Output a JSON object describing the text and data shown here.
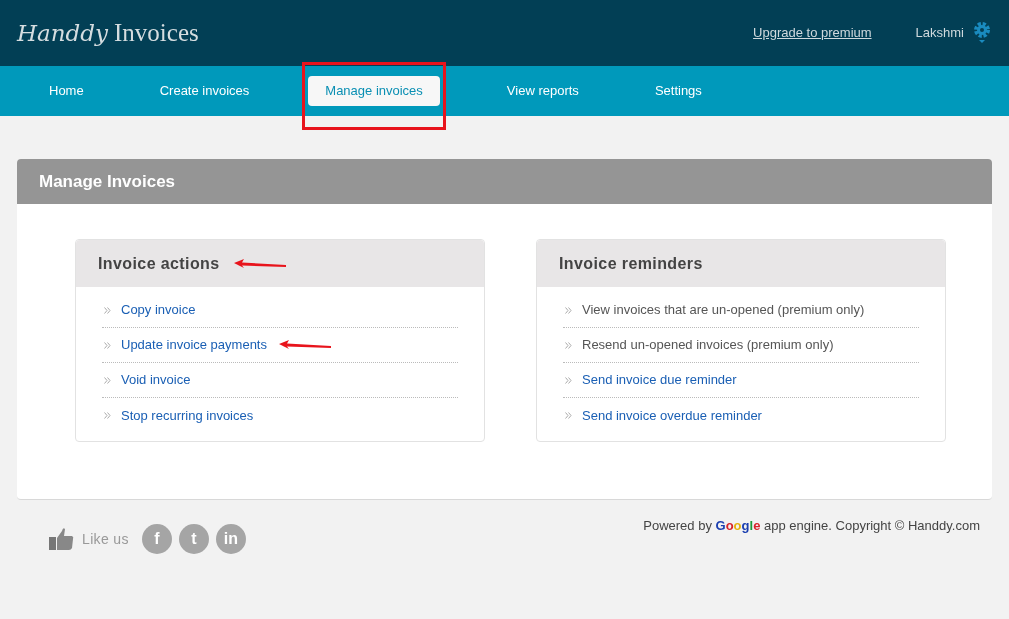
{
  "header": {
    "logo_script": "Handdy",
    "logo_text": "Invoices",
    "upgrade_link": "Upgrade to premium",
    "user": "Lakshmi"
  },
  "nav": [
    {
      "label": "Home",
      "selected": false,
      "highlighted": false
    },
    {
      "label": "Create invoices",
      "selected": false,
      "highlighted": false
    },
    {
      "label": "Manage invoices",
      "selected": true,
      "highlighted": true
    },
    {
      "label": "View reports",
      "selected": false,
      "highlighted": false
    },
    {
      "label": "Settings",
      "selected": false,
      "highlighted": false
    }
  ],
  "panel": {
    "title": "Manage Invoices",
    "sections": [
      {
        "title": "Invoice actions",
        "arrow": true,
        "items": [
          {
            "label": "Copy invoice",
            "disabled": false,
            "arrow": false
          },
          {
            "label": "Update invoice payments",
            "disabled": false,
            "arrow": true
          },
          {
            "label": "Void invoice",
            "disabled": false,
            "arrow": false
          },
          {
            "label": "Stop recurring invoices",
            "disabled": false,
            "arrow": false
          }
        ]
      },
      {
        "title": "Invoice reminders",
        "arrow": false,
        "items": [
          {
            "label": "View invoices that are un-opened (premium only)",
            "disabled": true,
            "arrow": false
          },
          {
            "label": "Resend un-opened invoices (premium only)",
            "disabled": true,
            "arrow": false
          },
          {
            "label": "Send invoice due reminder",
            "disabled": false,
            "arrow": false
          },
          {
            "label": "Send invoice overdue reminder",
            "disabled": false,
            "arrow": false
          }
        ]
      }
    ]
  },
  "footer": {
    "like_us": "Like us",
    "social": [
      {
        "glyph": "f"
      },
      {
        "glyph": "t"
      },
      {
        "glyph": "in"
      }
    ],
    "powered_by": "Powered by",
    "google": "Google",
    "copyright": "app engine. Copyright © Handdy.com"
  }
}
